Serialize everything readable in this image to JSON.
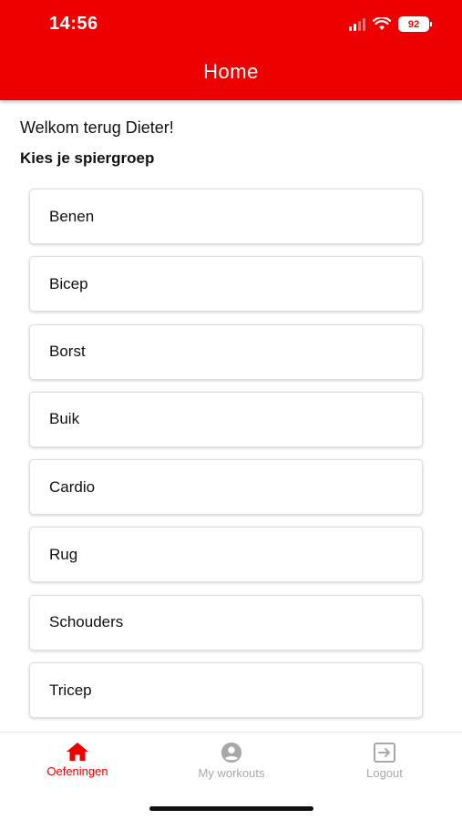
{
  "status_bar": {
    "time": "14:56",
    "battery": "92"
  },
  "header": {
    "title": "Home"
  },
  "welcome_text": "Welkom terug Dieter!",
  "section_title": "Kies je spiergroep",
  "muscle_groups": [
    "Benen",
    "Bicep",
    "Borst",
    "Buik",
    "Cardio",
    "Rug",
    "Schouders",
    "Tricep"
  ],
  "tabs": [
    {
      "label": "Oefeningen",
      "icon": "home-icon",
      "active": true
    },
    {
      "label": "My workouts",
      "icon": "account-circle-icon",
      "active": false
    },
    {
      "label": "Logout",
      "icon": "logout-icon",
      "active": false
    }
  ],
  "colors": {
    "accent": "#ee0000",
    "inactive": "#a8a8a8"
  }
}
